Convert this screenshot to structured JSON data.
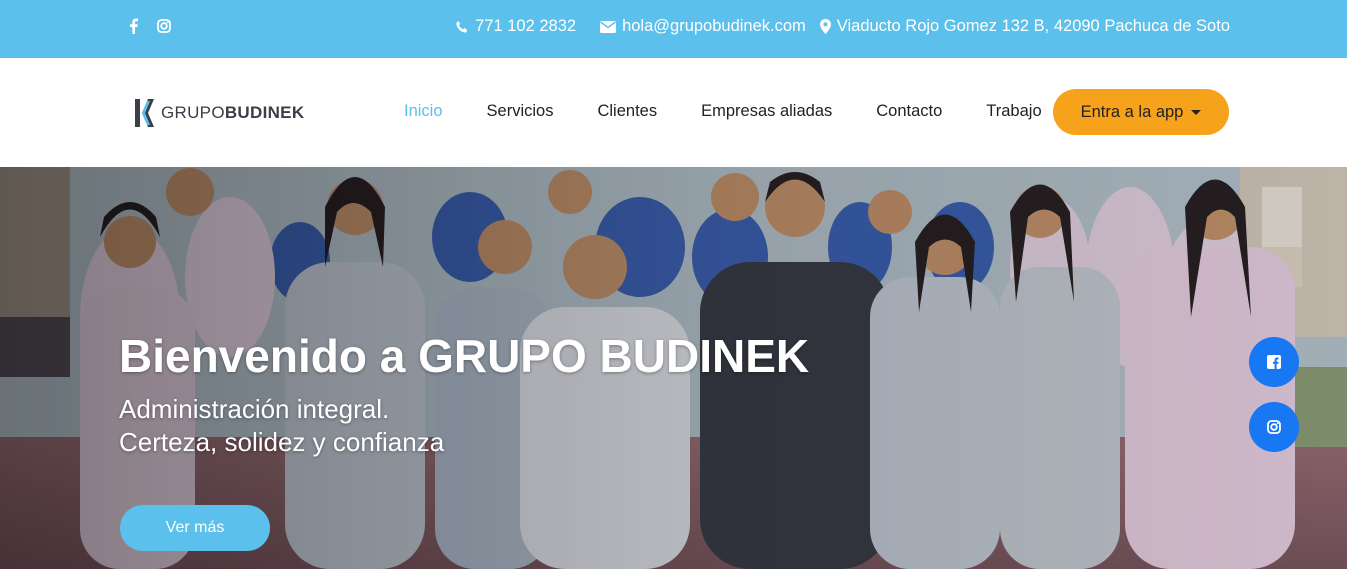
{
  "topbar": {
    "social_icons": [
      "facebook-icon",
      "instagram-icon"
    ],
    "phone": "771 102 2832",
    "email": "hola@grupobudinek.com",
    "address": "Viaducto Rojo Gomez 132 B, 42090 Pachuca de Soto"
  },
  "brand": {
    "word1": "GRUPO",
    "word2": "BUDINEK"
  },
  "nav": {
    "items": [
      {
        "label": "Inicio",
        "active": true
      },
      {
        "label": "Servicios"
      },
      {
        "label": "Clientes"
      },
      {
        "label": "Empresas aliadas"
      },
      {
        "label": "Contacto"
      },
      {
        "label": "Trabajo"
      }
    ],
    "app_button": "Entra a la app"
  },
  "hero": {
    "title": "Bienvenido a GRUPO BUDINEK",
    "subtitle_line1": "Administración integral.",
    "subtitle_line2": "Certeza, solidez y confianza",
    "cta": "Ver más"
  },
  "floating_social": [
    "facebook-icon",
    "instagram-icon"
  ],
  "colors": {
    "accent_blue": "#5bc0eb",
    "cta_orange": "#f7a21b",
    "social_blue": "#1877f2"
  }
}
